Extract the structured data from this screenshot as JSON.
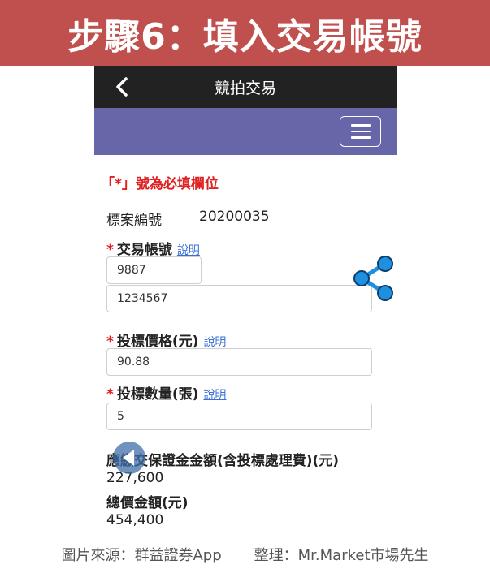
{
  "banner": {
    "title": "步驟6：填入交易帳號"
  },
  "header": {
    "title": "競拍交易",
    "back_icon": "chevron-left-icon",
    "menu_icon": "hamburger-menu-icon"
  },
  "form": {
    "required_note": "「*」號為必填欄位",
    "case_no_label": "標案編號",
    "case_no_value": "20200035",
    "required_mark": "*",
    "account_label": "交易帳號",
    "account_help": "說明",
    "account_branch": "9887",
    "account_number": "1234567",
    "price_label": "投標價格(元)",
    "price_help": "說明",
    "price_value": "90.88",
    "qty_label": "投標數量(張)",
    "qty_help": "說明",
    "qty_value": "5",
    "deposit_label": "應繳交保證金金額(含投標處理費)(元)",
    "deposit_value": "227,600",
    "total_label": "總價金額(元)",
    "total_value": "454,400"
  },
  "footer": {
    "source": "圖片來源：群益證券App",
    "compiled": "整理：Mr.Market市場先生"
  },
  "colors": {
    "banner": "#c0504d",
    "header": "#222222",
    "subbar": "#6666a8",
    "required": "#e02020",
    "link": "#3a6fd8",
    "share": "#1f8fe0"
  }
}
